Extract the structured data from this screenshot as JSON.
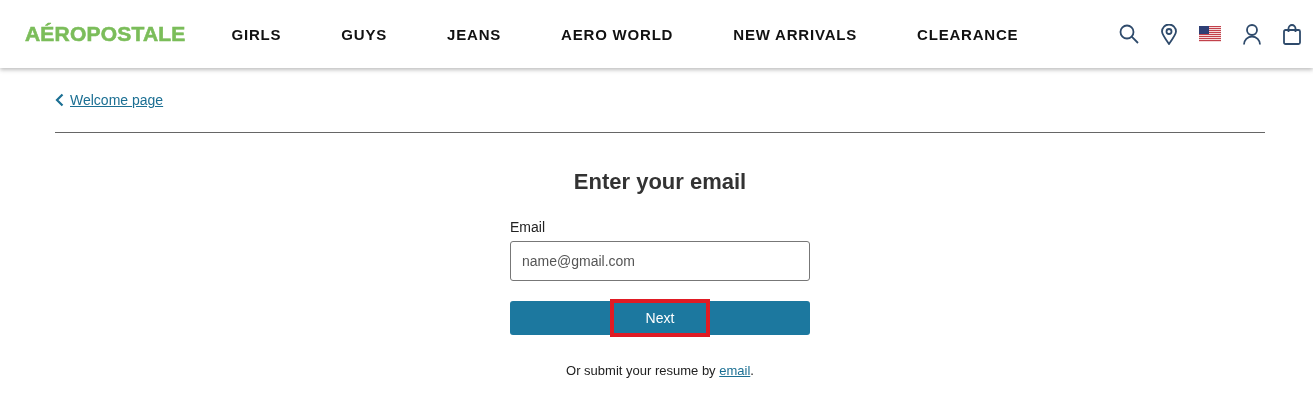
{
  "header": {
    "logo": "AÉROPOSTALE",
    "nav": [
      "GIRLS",
      "GUYS",
      "JEANS",
      "AERO WORLD",
      "NEW ARRIVALS",
      "CLEARANCE"
    ]
  },
  "back_link": {
    "label": "Welcome page"
  },
  "form": {
    "title": "Enter your email",
    "email_label": "Email",
    "email_placeholder": "name@gmail.com",
    "next_button": {
      "label": "Next",
      "highlighted": true
    },
    "footer": {
      "prefix": "Or submit your resume by ",
      "link": "email",
      "suffix": "."
    }
  }
}
